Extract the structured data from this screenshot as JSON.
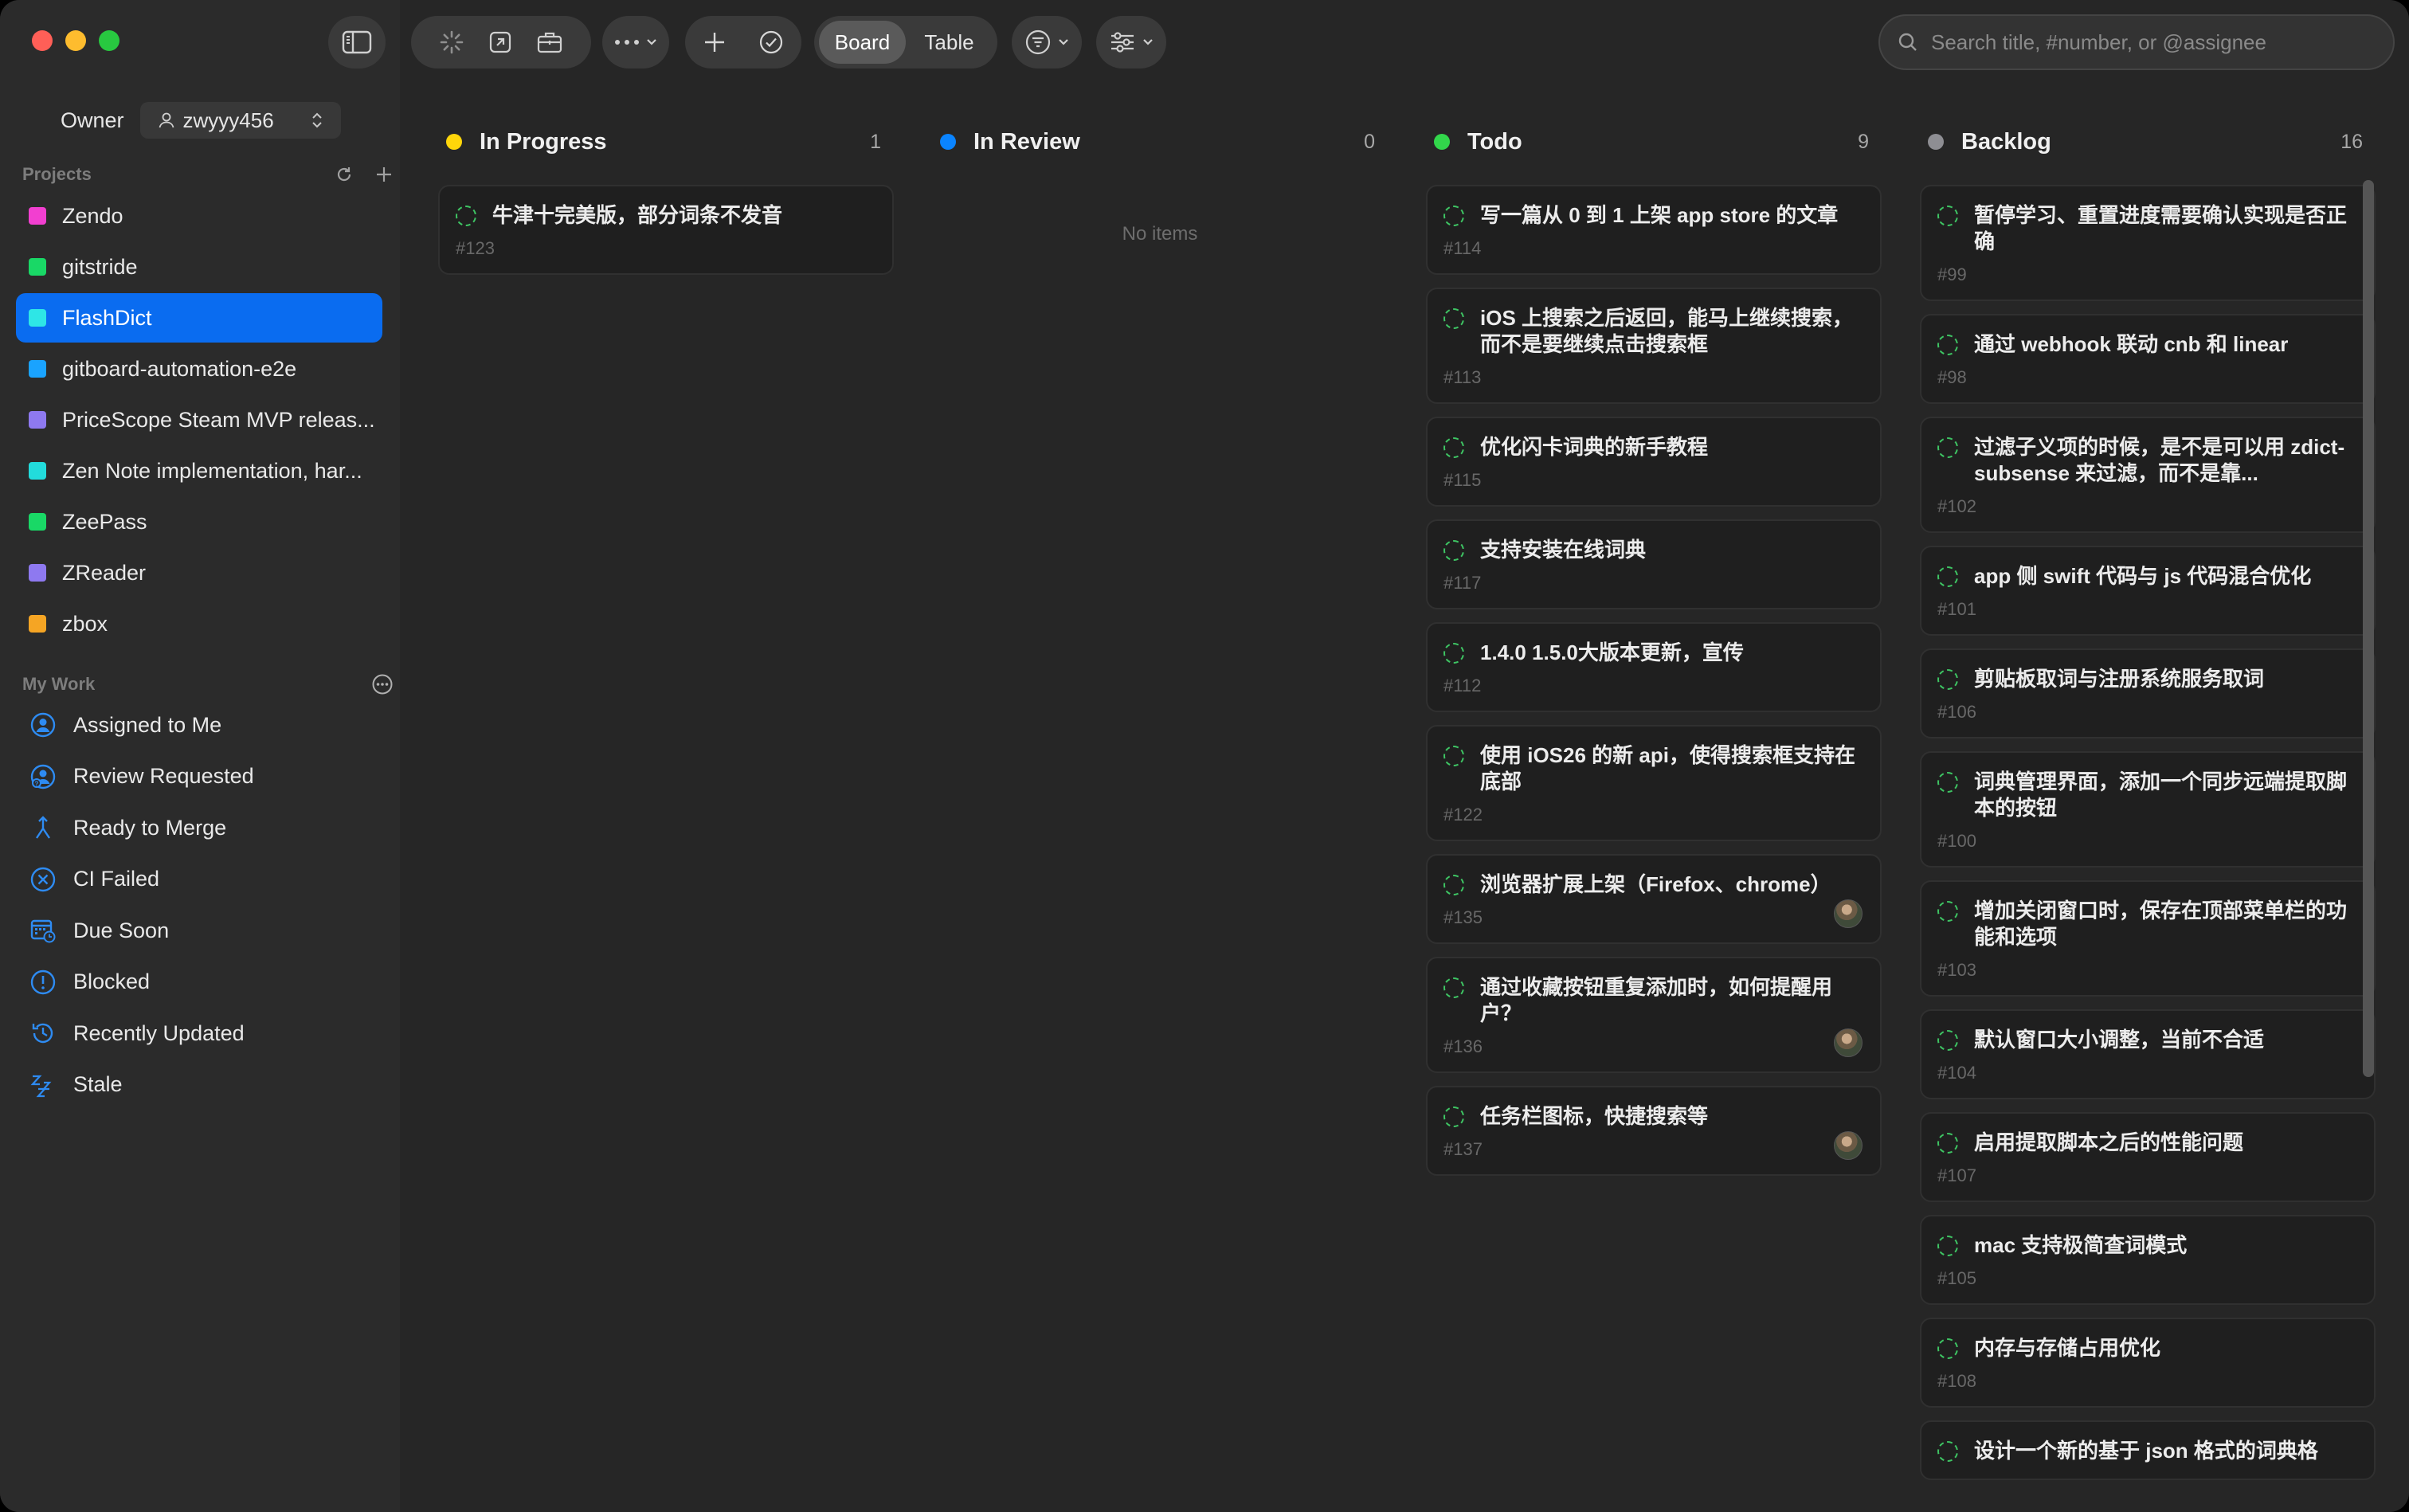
{
  "window": {
    "owner": {
      "label": "Owner",
      "value": "zwyyy456"
    }
  },
  "toolbar": {
    "view_board": "Board",
    "view_table": "Table",
    "search_placeholder": "Search title, #number, or @assignee"
  },
  "sidebar": {
    "projects_heading": "Projects",
    "projects": [
      {
        "label": "Zendo",
        "color": "#f23fd0"
      },
      {
        "label": "gitstride",
        "color": "#19d866"
      },
      {
        "label": "FlashDict",
        "color": "#2ee6e6",
        "active": true
      },
      {
        "label": "gitboard-automation-e2e",
        "color": "#1aa3ff"
      },
      {
        "label": "PriceScope Steam MVP releas...",
        "color": "#8e79f0"
      },
      {
        "label": "Zen Note implementation, har...",
        "color": "#22dcdc"
      },
      {
        "label": "ZeePass",
        "color": "#19d866"
      },
      {
        "label": "ZReader",
        "color": "#8e79f0"
      },
      {
        "label": "zbox",
        "color": "#f5a524"
      }
    ],
    "mywork_heading": "My Work",
    "mywork": [
      {
        "label": "Assigned to Me",
        "icon": "person-circle-icon"
      },
      {
        "label": "Review Requested",
        "icon": "review-person-icon"
      },
      {
        "label": "Ready to Merge",
        "icon": "merge-icon"
      },
      {
        "label": "CI Failed",
        "icon": "x-circle-icon"
      },
      {
        "label": "Due Soon",
        "icon": "calendar-clock-icon"
      },
      {
        "label": "Blocked",
        "icon": "exclamation-circle-icon"
      },
      {
        "label": "Recently Updated",
        "icon": "history-icon"
      },
      {
        "label": "Stale",
        "icon": "zzz-icon"
      }
    ],
    "accent_color": "#2e8bf2"
  },
  "board": {
    "columns": [
      {
        "title": "In Progress",
        "count": "1",
        "color": "#ffd60a",
        "cards": [
          {
            "title": "牛津十完美版，部分词条不发音",
            "number": "#123"
          }
        ]
      },
      {
        "title": "In Review",
        "count": "0",
        "color": "#0a84ff",
        "empty_text": "No items",
        "cards": []
      },
      {
        "title": "Todo",
        "count": "9",
        "color": "#32d74b",
        "cards": [
          {
            "title": "写一篇从 0 到 1 上架 app store 的文章",
            "number": "#114"
          },
          {
            "title": "iOS 上搜索之后返回，能马上继续搜索，而不是要继续点击搜索框",
            "number": "#113"
          },
          {
            "title": "优化闪卡词典的新手教程",
            "number": "#115"
          },
          {
            "title": "支持安装在线词典",
            "number": "#117"
          },
          {
            "title": "1.4.0 1.5.0大版本更新，宣传",
            "number": "#112"
          },
          {
            "title": "使用 iOS26 的新 api，使得搜索框支持在底部",
            "number": "#122"
          },
          {
            "title": "浏览器扩展上架（Firefox、chrome）",
            "number": "#135",
            "avatar": true
          },
          {
            "title": "通过收藏按钮重复添加时，如何提醒用户？",
            "number": "#136",
            "avatar": true
          },
          {
            "title": "任务栏图标，快捷搜索等",
            "number": "#137",
            "avatar": true
          }
        ]
      },
      {
        "title": "Backlog",
        "count": "16",
        "color": "#8e8e93",
        "cards": [
          {
            "title": "暂停学习、重置进度需要确认实现是否正确",
            "number": "#99"
          },
          {
            "title": "通过 webhook 联动 cnb 和 linear",
            "number": "#98"
          },
          {
            "title": "过滤子义项的时候，是不是可以用 zdict-subsense 来过滤，而不是靠...",
            "number": "#102"
          },
          {
            "title": "app 侧 swift 代码与 js 代码混合优化",
            "number": "#101"
          },
          {
            "title": "剪贴板取词与注册系统服务取词",
            "number": "#106"
          },
          {
            "title": "词典管理界面，添加一个同步远端提取脚本的按钮",
            "number": "#100"
          },
          {
            "title": "增加关闭窗口时，保存在顶部菜单栏的功能和选项",
            "number": "#103"
          },
          {
            "title": "默认窗口大小调整，当前不合适",
            "number": "#104"
          },
          {
            "title": "启用提取脚本之后的性能问题",
            "number": "#107"
          },
          {
            "title": "mac 支持极简查词模式",
            "number": "#105"
          },
          {
            "title": "内存与存储占用优化",
            "number": "#108"
          },
          {
            "title": "设计一个新的基于 json 格式的词典格",
            "number": ""
          }
        ]
      }
    ]
  }
}
